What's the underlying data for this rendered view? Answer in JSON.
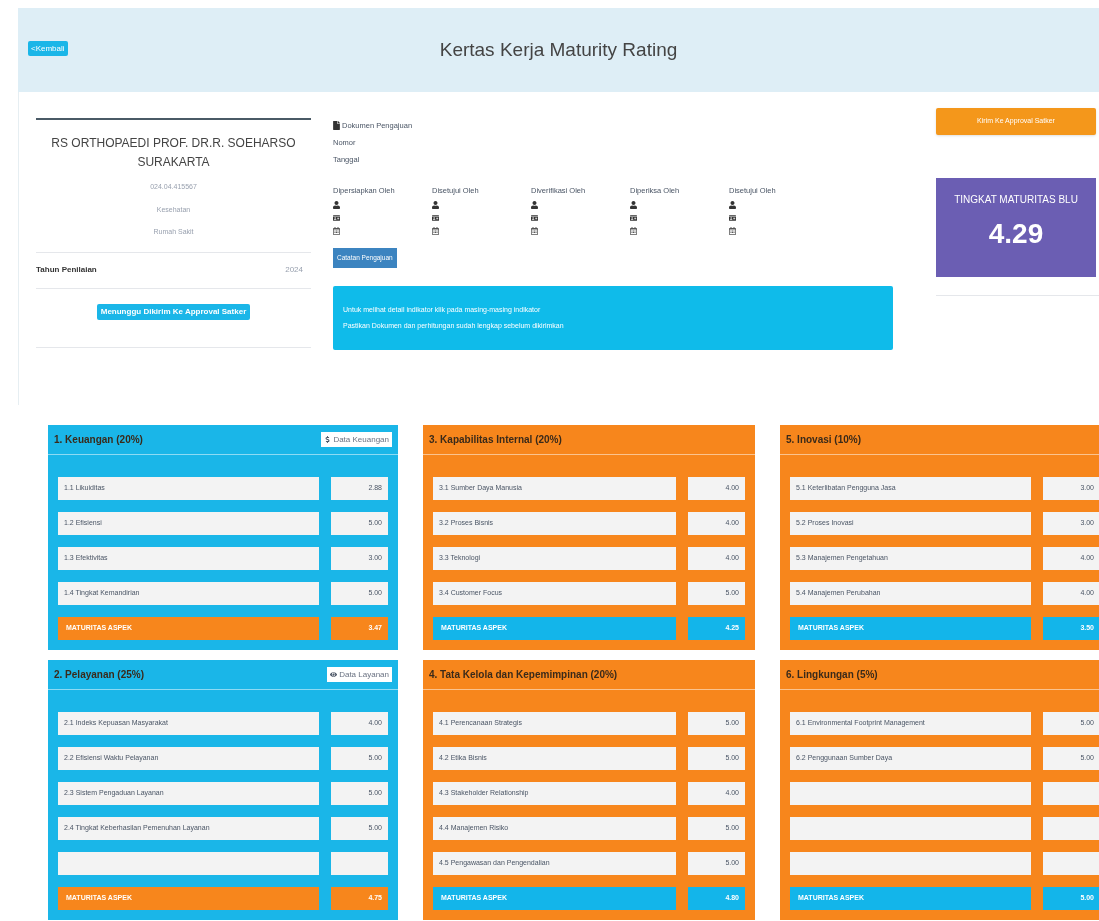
{
  "header": {
    "back_button": "<Kembali",
    "title": "Kertas Kerja Maturity Rating"
  },
  "unit_card": {
    "name": "RS ORTHOPAEDI PROF. DR.R. SOEHARSO SURAKARTA",
    "code": "024.04.415567",
    "sector": "Kesehatan",
    "type": "Rumah Sakit",
    "year_label": "Tahun Penilaian",
    "year": "2024",
    "status_button": "Menunggu Dikirim Ke Approval Satker"
  },
  "document": {
    "title": "Dokumen Pengajuan",
    "number_label": "Nomor",
    "date_label": "Tanggal",
    "signatories": [
      {
        "label": "Dipersiapkan Oleh"
      },
      {
        "label": "Disetujui Oleh"
      },
      {
        "label": "Diverifikasi Oleh"
      },
      {
        "label": "Diperiksa Oleh"
      },
      {
        "label": "Disetujui Oleh"
      }
    ],
    "notes_button": "Catatan Pengajuan",
    "alert": [
      "Untuk melihat detail indikator klik pada masing-masing indikator",
      "Pastikan Dokumen dan perhitungan sudah lengkap sebelum dikirimkan"
    ]
  },
  "send_button": "Kirim Ke Approval Satker",
  "score": {
    "label": "TINGKAT MATURITAS BLU",
    "value": "4.29"
  },
  "columns": [
    {
      "aspects": [
        {
          "title": "1. Keuangan (20%)",
          "kind": "info",
          "button": {
            "label": "Data Keuangan"
          },
          "indicators": [
            {
              "kind": "item",
              "label": "1.1 Likuiditas",
              "value": "2.88"
            },
            {
              "kind": "item",
              "label": "1.2 Efisiensi",
              "value": "5.00"
            },
            {
              "kind": "item",
              "label": "1.3 Efektivitas",
              "value": "3.00"
            },
            {
              "kind": "item",
              "label": "1.4 Tingkat Kemandirian",
              "value": "5.00"
            }
          ],
          "summary": {
            "label": "MATURITAS ASPEK",
            "value": "3.47"
          }
        },
        {
          "title": "2. Pelayanan (25%)",
          "kind": "info",
          "button": {
            "label": "Data Layanan"
          },
          "indicators": [
            {
              "kind": "item",
              "label": "2.1 Indeks Kepuasan Masyarakat",
              "value": "4.00"
            },
            {
              "kind": "item",
              "label": "2.2 Efisiensi Waktu Pelayanan",
              "value": "5.00"
            },
            {
              "kind": "item",
              "label": "2.3 Sistem Pengaduan Layanan",
              "value": "5.00"
            },
            {
              "kind": "item",
              "label": "2.4 Tingkat Keberhasilan Pemenuhan Layanan",
              "value": "5.00"
            },
            {
              "kind": "blank"
            }
          ],
          "summary": {
            "label": "MATURITAS ASPEK",
            "value": "4.75"
          }
        }
      ]
    },
    {
      "aspects": [
        {
          "title": "3. Kapabilitas Internal (20%)",
          "kind": "warning",
          "indicators": [
            {
              "kind": "item",
              "label": "3.1 Sumber Daya Manusia",
              "value": "4.00"
            },
            {
              "kind": "item",
              "label": "3.2 Proses Bisnis",
              "value": "4.00"
            },
            {
              "kind": "item",
              "label": "3.3 Teknologi",
              "value": "4.00"
            },
            {
              "kind": "item",
              "label": "3.4 Customer Focus",
              "value": "5.00"
            }
          ],
          "summary": {
            "label": "MATURITAS ASPEK",
            "value": "4.25"
          }
        },
        {
          "title": "4. Tata Kelola dan Kepemimpinan (20%)",
          "kind": "warning",
          "indicators": [
            {
              "kind": "item",
              "label": "4.1 Perencanaan Strategis",
              "value": "5.00"
            },
            {
              "kind": "item",
              "label": "4.2 Etika Bisnis",
              "value": "5.00"
            },
            {
              "kind": "item",
              "label": "4.3 Stakeholder Relationship",
              "value": "4.00"
            },
            {
              "kind": "item",
              "label": "4.4 Manajemen Risiko",
              "value": "5.00"
            },
            {
              "kind": "item",
              "label": "4.5 Pengawasan dan Pengendalian",
              "value": "5.00"
            }
          ],
          "summary": {
            "label": "MATURITAS ASPEK",
            "value": "4.80"
          }
        }
      ]
    },
    {
      "aspects": [
        {
          "title": "5. Inovasi (10%)",
          "kind": "warning",
          "indicators": [
            {
              "kind": "item",
              "label": "5.1 Keterlibatan Pengguna Jasa",
              "value": "3.00"
            },
            {
              "kind": "item",
              "label": "5.2 Proses Inovasi",
              "value": "3.00"
            },
            {
              "kind": "item",
              "label": "5.3 Manajemen Pengetahuan",
              "value": "4.00"
            },
            {
              "kind": "item",
              "label": "5.4 Manajemen Perubahan",
              "value": "4.00"
            }
          ],
          "summary": {
            "label": "MATURITAS ASPEK",
            "value": "3.50"
          }
        },
        {
          "title": "6. Lingkungan (5%)",
          "kind": "warning",
          "indicators": [
            {
              "kind": "item",
              "label": "6.1 Environmental Footprint Management",
              "value": "5.00"
            },
            {
              "kind": "item",
              "label": "6.2 Penggunaan Sumber Daya",
              "value": "5.00"
            },
            {
              "kind": "blank"
            },
            {
              "kind": "blank"
            },
            {
              "kind": "blank"
            }
          ],
          "summary": {
            "label": "MATURITAS ASPEK",
            "value": "5.00"
          }
        }
      ]
    }
  ]
}
